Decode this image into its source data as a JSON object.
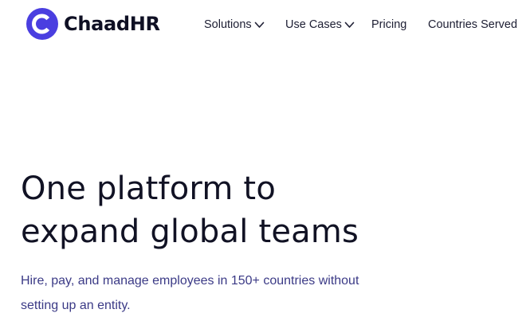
{
  "brand": {
    "name": "ChaadHR",
    "accent_color": "#4a3ee0",
    "text_color": "#0f1024"
  },
  "nav": {
    "items": [
      {
        "label": "Solutions",
        "has_dropdown": true,
        "icon": "chevron-down-icon"
      },
      {
        "label": "Use Cases",
        "has_dropdown": true,
        "icon": "chevron-down-icon"
      },
      {
        "label": "Pricing",
        "has_dropdown": false
      },
      {
        "label": "Countries Served",
        "has_dropdown": false
      }
    ]
  },
  "hero": {
    "title_line_1": "One platform to",
    "title_line_2": "expand global teams",
    "subtitle_line_1": "Hire, pay, and manage employees in 150+ countries without",
    "subtitle_line_2": "setting up an entity.",
    "subtitle_color": "#3b3a86"
  }
}
